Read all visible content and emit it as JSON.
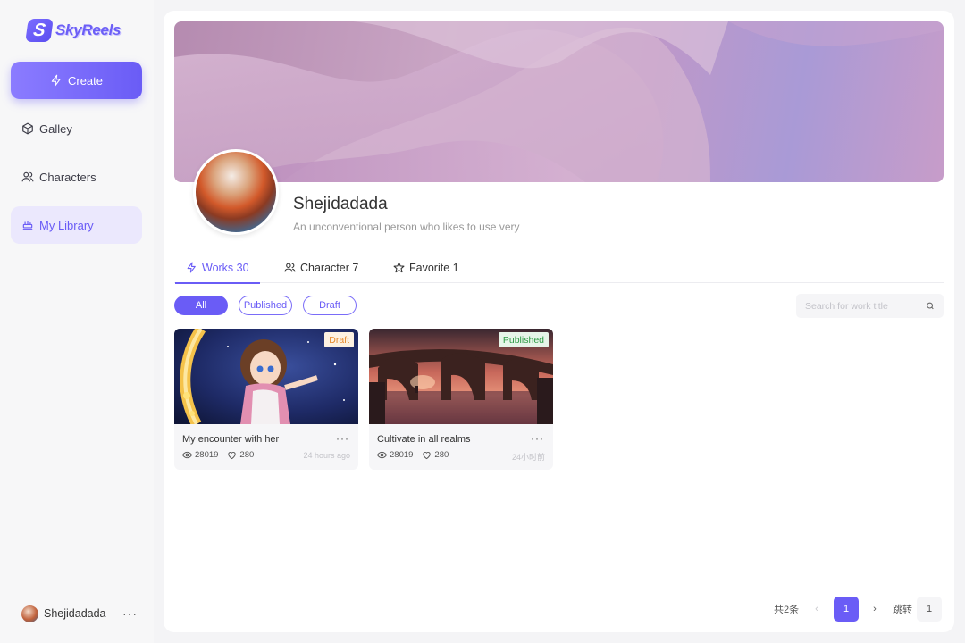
{
  "app": {
    "logo_text": "SkyReels",
    "logo_glyph": "S"
  },
  "sidebar": {
    "create_label": "Create",
    "items": [
      {
        "label": "Galley",
        "icon": "cube-icon"
      },
      {
        "label": "Characters",
        "icon": "users-icon"
      },
      {
        "label": "My Library",
        "icon": "library-icon",
        "active": true
      }
    ],
    "user": {
      "name": "Shejidadada",
      "more": "···"
    }
  },
  "profile": {
    "name": "Shejidadada",
    "bio": "An unconventional person who likes to use very"
  },
  "tabs": [
    {
      "label": "Works 30",
      "icon": "lightning-icon",
      "active": true
    },
    {
      "label": "Character 7",
      "icon": "users-icon"
    },
    {
      "label": "Favorite 1",
      "icon": "star-icon"
    }
  ],
  "filters": [
    {
      "label": "All",
      "active": true
    },
    {
      "label": "Published"
    },
    {
      "label": "Draft"
    }
  ],
  "search": {
    "placeholder": "Search for work title",
    "value": ""
  },
  "works": [
    {
      "title": "My encounter with her",
      "status": "Draft",
      "views": "28019",
      "likes": "280",
      "time": "24 hours ago",
      "more": "···"
    },
    {
      "title": "Cultivate in all realms",
      "status": "Published",
      "views": "28019",
      "likes": "280",
      "time": "24小时前",
      "more": "···"
    }
  ],
  "pagination": {
    "total": "共2条",
    "prev": "‹",
    "current": "1",
    "next": "›",
    "jump_label": "跳转",
    "jump_value": "1"
  },
  "colors": {
    "accent": "#6a5cf6",
    "draft_bg": "#fdf1e1",
    "draft_text": "#e6892b",
    "published_bg": "#e6f5e8",
    "published_text": "#2e9b45"
  }
}
